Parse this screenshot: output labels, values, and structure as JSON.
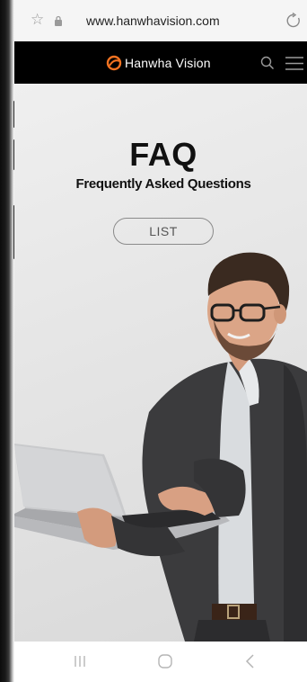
{
  "browser": {
    "url": "www.hanwhavision.com",
    "icons": [
      "star-icon",
      "lock-icon",
      "reload-icon"
    ]
  },
  "header": {
    "brand": "Hanwha Vision",
    "icons": [
      "hanwha-logo-icon",
      "search-icon",
      "menu-icon"
    ],
    "colors": {
      "background": "#000000",
      "logo_accent": "#f37321",
      "text": "#ffffff"
    }
  },
  "hero": {
    "title": "FAQ",
    "subtitle": "Frequently Asked Questions",
    "list_button_label": "LIST",
    "image": "man-with-laptop-photo"
  },
  "navbar": {
    "icons": [
      "recents-icon",
      "home-icon",
      "back-icon"
    ]
  }
}
